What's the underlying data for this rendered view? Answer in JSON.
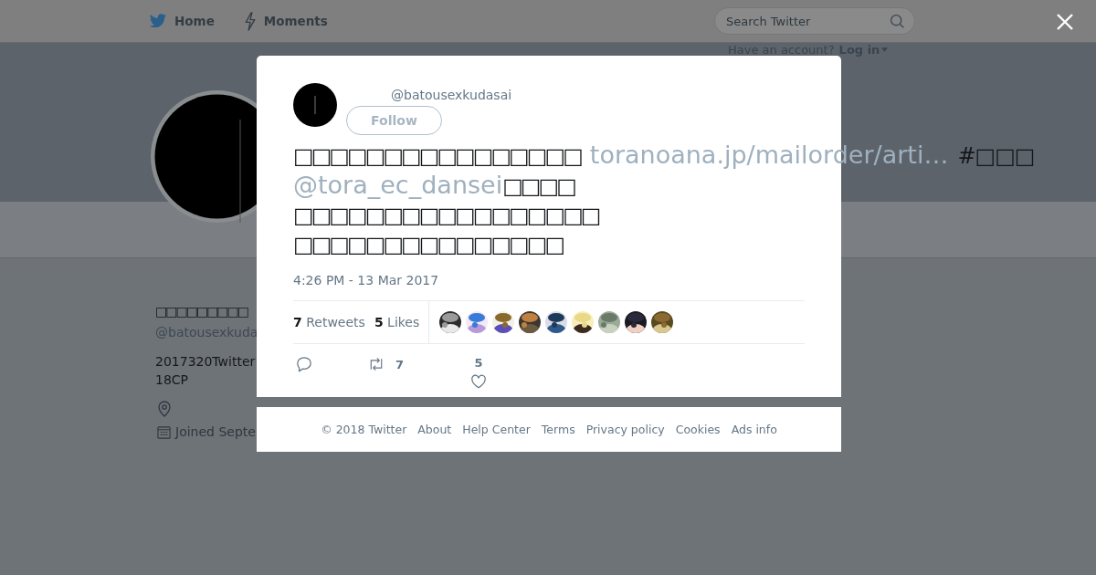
{
  "nav": {
    "items": [
      {
        "label": "Home",
        "kind": "home"
      },
      {
        "label": "Moments",
        "kind": "moments"
      }
    ],
    "search": {
      "placeholder": "Search Twitter"
    },
    "account_prompt": "Have an account?",
    "login": "Log in"
  },
  "profile": {
    "name": "□□□□□□□□□",
    "handle": "@batousexkuda",
    "bio": [
      "2017320Twitter",
      "18CP"
    ],
    "joined": "Joined Septe"
  },
  "tweet": {
    "handle": "@batousexkudasai",
    "follow": "Follow",
    "lines": [
      [
        {
          "kind": "text",
          "text": "□□□□□□□□□□□□□□□□"
        },
        {
          "kind": "link",
          "text": "toranoana.jp/mailorder/arti…"
        },
        {
          "kind": "hashtag",
          "text": "#□□□"
        }
      ],
      [
        {
          "kind": "mention",
          "text": "@tora_ec_dansei"
        },
        {
          "kind": "text",
          "text": "□□□□"
        }
      ],
      [
        {
          "kind": "text",
          "text": "□□□□□□□□□□□□□□□□□"
        }
      ],
      [
        {
          "kind": "text",
          "text": "□□□□□□□□□□□□□□□"
        }
      ]
    ],
    "time": "4:26 PM - 13 Mar 2017",
    "retweets": {
      "count": "7",
      "label": "Retweets"
    },
    "likes": {
      "count": "5",
      "label": "Likes"
    },
    "liked_by": [
      {
        "kind": "picture"
      },
      {
        "kind": "picture"
      },
      {
        "kind": "picture"
      },
      {
        "kind": "picture"
      },
      {
        "kind": "picture"
      },
      {
        "kind": "picture"
      },
      {
        "kind": "picture"
      },
      {
        "kind": "picture"
      },
      {
        "kind": "picture"
      }
    ],
    "retweet_count": "7",
    "like_count": "5"
  },
  "footer": [
    "© 2018 Twitter",
    "About",
    "Help Center",
    "Terms",
    "Privacy policy",
    "Cookies",
    "Ads info"
  ]
}
